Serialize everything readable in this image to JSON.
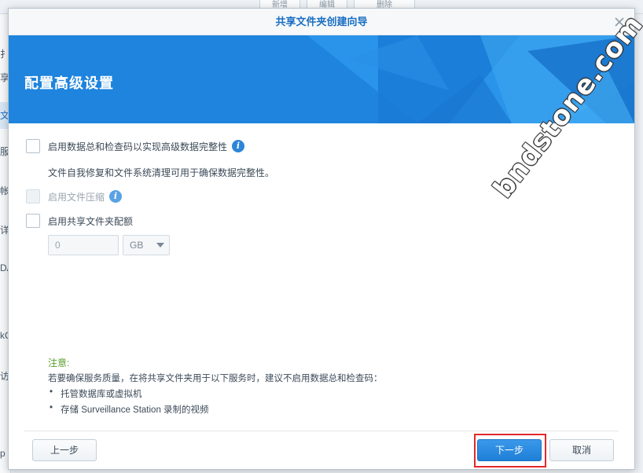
{
  "background_app": {
    "tabs": [
      "新增",
      "编辑",
      "删除"
    ],
    "sidebar_fragments": [
      "扌",
      "享",
      "文件",
      "服务",
      "帐号",
      "详细",
      "DA",
      "kC",
      "访问",
      "p s"
    ]
  },
  "dialog": {
    "title": "共享文件夹创建向导",
    "banner_title": "配置高级设置",
    "options": {
      "checksum_label": "启用数据总和检查码以实现高级数据完整性",
      "checksum_desc": "文件自我修复和文件系统清理可用于确保数据完整性。",
      "compression_label": "启用文件压缩",
      "quota_label": "启用共享文件夹配额",
      "quota_value_placeholder": "0",
      "quota_unit": "GB"
    },
    "note": {
      "title": "注意:",
      "text": "若要确保服务质量，在将共享文件夹用于以下服务时，建议不启用数据总和检查码：",
      "bullets": [
        "托管数据库或虚拟机",
        "存储 Surveillance Station 录制的视频"
      ]
    },
    "buttons": {
      "prev": "上一步",
      "next": "下一步",
      "cancel": "取消"
    }
  },
  "watermark": "bndstone.com",
  "colors": {
    "accent": "#1f86e0",
    "title_text": "#1a6ec1",
    "note_title": "#5aa02c",
    "highlight": "#e0292b"
  },
  "icons": {
    "close": "close-icon",
    "info": "info-icon",
    "dropdown": "chevron-down-icon"
  }
}
